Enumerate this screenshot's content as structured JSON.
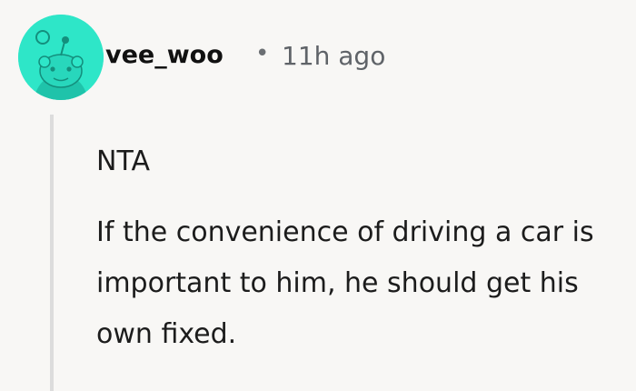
{
  "comment": {
    "username": "vee_woo",
    "separator": "•",
    "timestamp": "11h ago",
    "paragraphs": [
      "NTA",
      "If the convenience of driving a car is important to him, he should get his own fixed."
    ],
    "avatar_icon": "reddit-snoo-avatar-icon"
  },
  "colors": {
    "background": "#f8f7f5",
    "avatar": "#2ee6c8",
    "username": "#111111",
    "meta": "#5f6368",
    "thread_line": "#dcdcdc",
    "body": "#1c1c1c"
  }
}
